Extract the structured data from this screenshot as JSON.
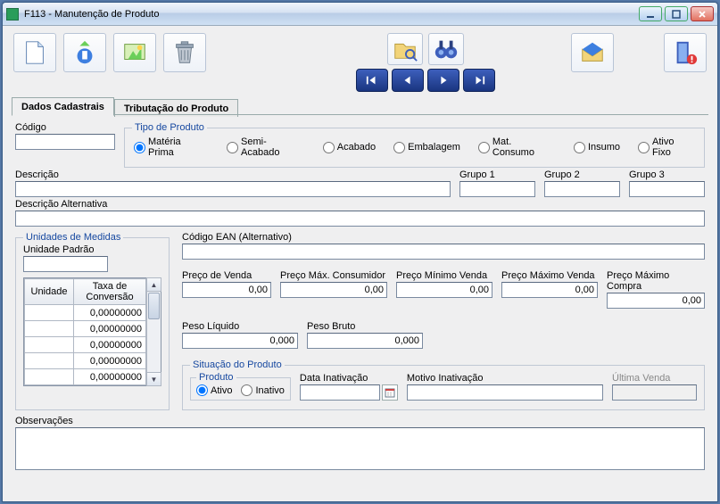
{
  "window": {
    "title": "F113 - Manutenção de Produto"
  },
  "tabs": {
    "t1": "Dados Cadastrais",
    "t2": "Tributação do Produto"
  },
  "labels": {
    "codigo": "Código",
    "tipo_produto": "Tipo de Produto",
    "descricao": "Descrição",
    "grupo1": "Grupo 1",
    "grupo2": "Grupo 2",
    "grupo3": "Grupo 3",
    "descricao_alt": "Descrição Alternativa",
    "unidades": "Unidades de Medidas",
    "unidade_padrao": "Unidade Padrão",
    "codigo_ean": "Código EAN (Alternativo)",
    "preco_venda": "Preço de Venda",
    "preco_max_cons": "Preço Máx. Consumidor",
    "preco_min_venda": "Preço Mínimo Venda",
    "preco_max_venda": "Preço Máximo Venda",
    "preco_max_compra": "Preço Máximo Compra",
    "peso_liquido": "Peso Líquido",
    "peso_bruto": "Peso Bruto",
    "situacao": "Situação do Produto",
    "produto": "Produto",
    "data_inativacao": "Data Inativação",
    "motivo_inativacao": "Motivo Inativação",
    "ultima_venda": "Última Venda",
    "observacoes": "Observações"
  },
  "tipo_options": {
    "materia_prima": "Matéria Prima",
    "semi_acabado": "Semi-Acabado",
    "acabado": "Acabado",
    "embalagem": "Embalagem",
    "mat_consumo": "Mat. Consumo",
    "insumo": "Insumo",
    "ativo_fixo": "Ativo Fixo"
  },
  "situacao_options": {
    "ativo": "Ativo",
    "inativo": "Inativo"
  },
  "grid": {
    "col_unidade": "Unidade",
    "col_taxa": "Taxa de Conversão",
    "cell_default": "0,00000000"
  },
  "values": {
    "preco_venda": "0,00",
    "preco_max_cons": "0,00",
    "preco_min_venda": "0,00",
    "preco_max_venda": "0,00",
    "preco_max_compra": "0,00",
    "peso_liquido": "0,000",
    "peso_bruto": "0,000"
  }
}
